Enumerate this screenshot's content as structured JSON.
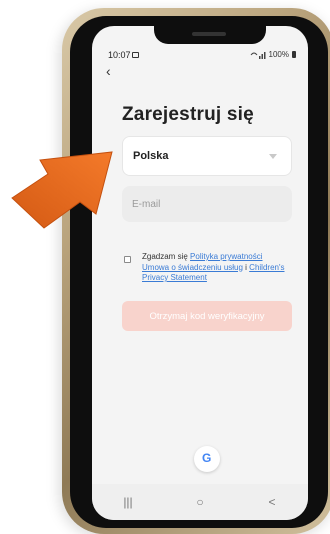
{
  "status_bar": {
    "time": "10:07",
    "right_text": "100%"
  },
  "page": {
    "title": "Zarejestruj się"
  },
  "country": {
    "value": "Polska"
  },
  "email": {
    "placeholder": "E-mail"
  },
  "consent": {
    "prefix": "Zgadzam się ",
    "privacy_link": "Polityka prywatności",
    "service_link": "Umowa o świadczeniu usług",
    "and": " i ",
    "children_link": "Children's Privacy Statement"
  },
  "actions": {
    "verify_label": "Otrzymaj kod weryfikacyjny"
  },
  "social": {
    "google_letter": "G"
  },
  "nav": {
    "recents": "|||",
    "home": "○",
    "back": "<"
  },
  "colors": {
    "accent_disabled": "#f8d3cc",
    "link": "#3a7bd5",
    "arrow": "#ee6a1d"
  }
}
